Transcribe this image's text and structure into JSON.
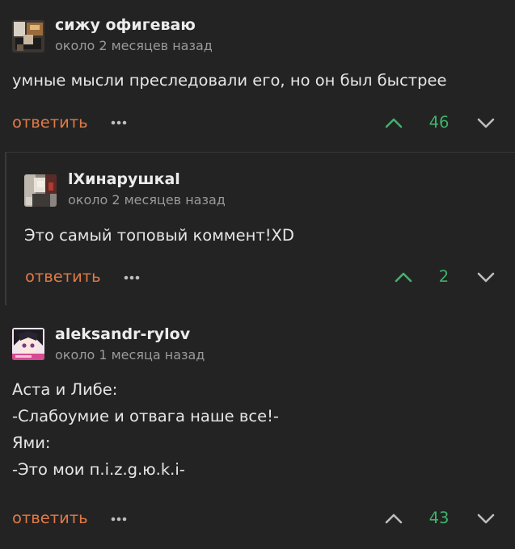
{
  "comments": [
    {
      "username": "сижу офигеваю",
      "timestamp": "около 2 месяцев назад",
      "lines": [
        "умные мысли преследовали его, но он был быстрее"
      ],
      "reply_label": "ответить",
      "score": "46"
    },
    {
      "username": "lХинарушкаl",
      "timestamp": "около 2 месяцев назад",
      "lines": [
        "Это самый топовый коммент!XD"
      ],
      "reply_label": "ответить",
      "score": "2"
    },
    {
      "username": "aleksandr-rylov",
      "timestamp": "около 1 месяца назад",
      "lines": [
        "Аста и Либе:",
        "-Слабоумие и отвага наше все!-",
        "Ями:",
        "-Это мои п.i.z.g.ю.k.i-"
      ],
      "reply_label": "ответить",
      "score": "43"
    }
  ],
  "icons": {
    "more": "more-dots-icon",
    "upvote": "chevron-up-icon",
    "downvote": "chevron-down-icon"
  },
  "colors": {
    "background": "#232323",
    "reply_link": "#e07a47",
    "score": "#3fb26b",
    "upvote_active": "#3fb26b",
    "arrow_idle": "#bdbdbd"
  }
}
